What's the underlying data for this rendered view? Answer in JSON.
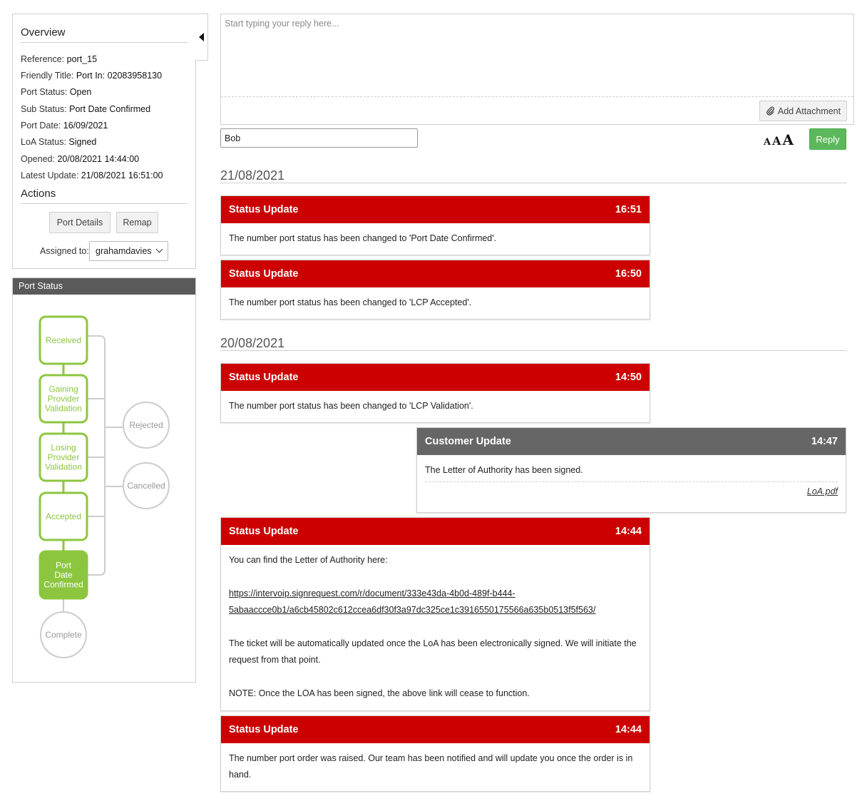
{
  "overview": {
    "title": "Overview",
    "rows": [
      {
        "label": "Reference: ",
        "value": "port_15"
      },
      {
        "label": "Friendly Title: ",
        "value": "Port In: 02083958130"
      },
      {
        "label": "Port Status: ",
        "value": "Open"
      },
      {
        "label": "Sub Status: ",
        "value": "Port Date Confirmed"
      },
      {
        "label": "Port Date: ",
        "value": "16/09/2021"
      },
      {
        "label": "LoA Status: ",
        "value": "Signed"
      },
      {
        "label": "Opened: ",
        "value": "20/08/2021 14:44:00"
      },
      {
        "label": "Latest Update: ",
        "value": "21/08/2021 16:51:00"
      }
    ],
    "actions_title": "Actions",
    "port_details_label": "Port Details",
    "remap_label": "Remap",
    "assigned_label": "Assigned to:",
    "assigned_value": "grahamdavies"
  },
  "port_status": {
    "title": "Port Status",
    "steps": [
      {
        "lines": [
          "Received"
        ],
        "state": "done"
      },
      {
        "lines": [
          "Gaining",
          "Provider",
          "Validation"
        ],
        "state": "done"
      },
      {
        "lines": [
          "Losing",
          "Provider",
          "Validation"
        ],
        "state": "done"
      },
      {
        "lines": [
          "Accepted"
        ],
        "state": "done"
      },
      {
        "lines": [
          "Port",
          "Date",
          "Confirmed"
        ],
        "state": "current"
      },
      {
        "lines": [
          "Complete"
        ],
        "state": "pending"
      }
    ],
    "side_states": [
      "Rejected",
      "Cancelled"
    ],
    "colors": {
      "green": "#8cc63f",
      "grey": "#cccccc",
      "text_grey": "#999999"
    }
  },
  "reply": {
    "placeholder": "Start typing your reply here...",
    "attach_label": "Add Attachment",
    "name_value": "Bob",
    "font_sizes": [
      "A",
      "A",
      "A"
    ],
    "reply_label": "Reply"
  },
  "timeline": {
    "groups": [
      {
        "date": "21/08/2021",
        "entries": [
          {
            "title": "Status Update",
            "time": "16:51",
            "body": [
              "The number port status has been changed to 'Port Date Confirmed'."
            ]
          },
          {
            "title": "Status Update",
            "time": "16:50",
            "body": [
              "The number port status has been changed to 'LCP Accepted'."
            ]
          }
        ]
      },
      {
        "date": "20/08/2021",
        "entries": [
          {
            "title": "Status Update",
            "time": "14:50",
            "body": [
              "The number port status has been changed to 'LCP Validation'."
            ]
          },
          {
            "title": "Customer Update",
            "time": "14:47",
            "body": [
              "The Letter of Authority has been signed."
            ],
            "attachment": "LoA.pdf"
          },
          {
            "title": "Status Update",
            "time": "14:44",
            "body": [
              "You can find the Letter of Authority here:"
            ],
            "link_lines": [
              "https://intervoip.signrequest.com/r/document/333e43da-4b0d-489f-b444-",
              "5abaaccce0b1/a6cb45802c612ccea6df30f3a97dc325ce1c3916550175566a635b0513f5f563/"
            ],
            "body2": [
              "The ticket will be automatically updated once the LoA has been electronically signed. We will initiate the",
              "request from that point."
            ],
            "body3": [
              "NOTE: Once the LOA has been signed, the above link will cease to function."
            ]
          },
          {
            "title": "Status Update",
            "time": "14:44",
            "body": [
              "The number port order was raised. Our team has been notified and will update you once the order is in",
              "hand."
            ]
          }
        ]
      }
    ],
    "colors": {
      "status_header": "#cc0000",
      "customer_header": "#666666"
    }
  }
}
